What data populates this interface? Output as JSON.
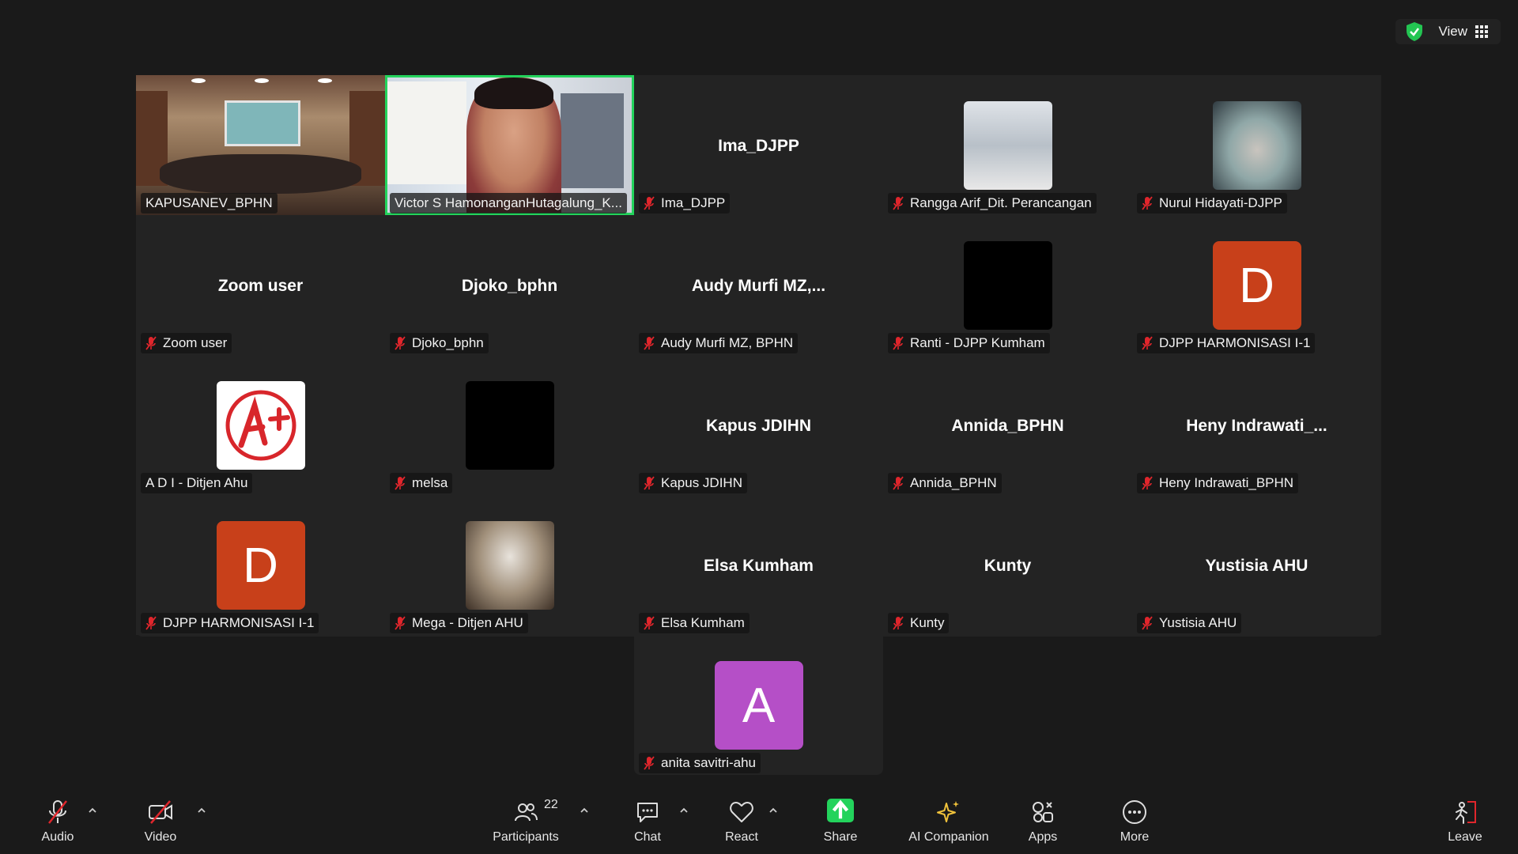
{
  "top": {
    "view_label": "View"
  },
  "tiles": [
    {
      "name": "KAPUSANEV_BPHN"
    },
    {
      "name": "Victor S HamonanganHutagalung_K..."
    },
    {
      "big": "Ima_DJPP",
      "name": "Ima_DJPP"
    },
    {
      "name": "Rangga Arif_Dit. Perancangan"
    },
    {
      "name": "Nurul Hidayati-DJPP"
    },
    {
      "big": "Zoom user",
      "name": "Zoom user"
    },
    {
      "big": "Djoko_bphn",
      "name": "Djoko_bphn"
    },
    {
      "big": "Audy  Murfi  MZ,...",
      "name": "Audy Murfi MZ, BPHN"
    },
    {
      "name": "Ranti - DJPP Kumham"
    },
    {
      "avatar": "D",
      "name": "DJPP HARMONISASI I-1"
    },
    {
      "name": "A D I - Ditjen Ahu"
    },
    {
      "name": "melsa"
    },
    {
      "big": "Kapus JDIHN",
      "name": "Kapus JDIHN"
    },
    {
      "big": "Annida_BPHN",
      "name": "Annida_BPHN"
    },
    {
      "big": "Heny  Indrawati_...",
      "name": "Heny Indrawati_BPHN"
    },
    {
      "avatar": "D",
      "name": "DJPP HARMONISASI I-1"
    },
    {
      "name": "Mega - Ditjen AHU"
    },
    {
      "big": "Elsa Kumham",
      "name": "Elsa Kumham"
    },
    {
      "big": "Kunty",
      "name": "Kunty"
    },
    {
      "big": "Yustisia AHU",
      "name": "Yustisia AHU"
    },
    {
      "avatar": "A",
      "name": "anita savitri-ahu"
    }
  ],
  "toolbar": {
    "audio": "Audio",
    "video": "Video",
    "participants": "Participants",
    "participant_count": "22",
    "chat": "Chat",
    "react": "React",
    "share": "Share",
    "ai_companion": "AI Companion",
    "apps": "Apps",
    "more": "More",
    "leave": "Leave"
  },
  "colors": {
    "active_speaker": "#23d35c",
    "avatar_d": "#c8401a",
    "avatar_a": "#b54fc7",
    "muted": "#e0262c"
  }
}
